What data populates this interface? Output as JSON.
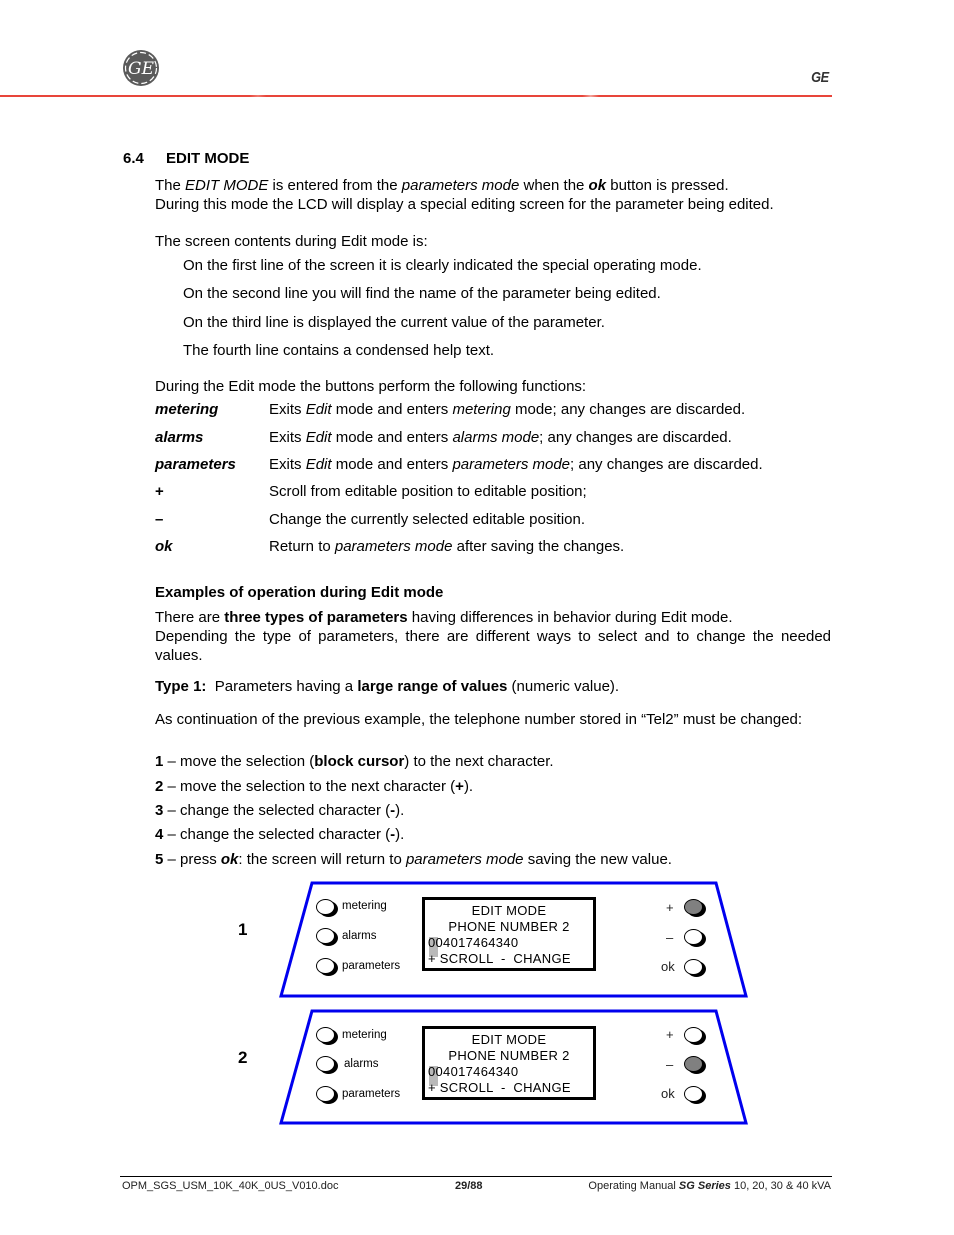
{
  "header": {
    "logo_icon": "ge-monogram-logo",
    "brand_text": "GE"
  },
  "section": {
    "number": "6.4",
    "title": "EDIT MODE"
  },
  "intro": {
    "l1_a": "The ",
    "l1_b": "EDIT MODE",
    "l1_c": " is entered from the ",
    "l1_d": "parameters mode",
    "l1_e": " when the ",
    "l1_f": "ok",
    "l1_g": " button is pressed.",
    "l2": "During this mode the LCD will display a special editing screen for the parameter being edited."
  },
  "screen_contents": {
    "heading": "The screen contents during Edit mode is:",
    "lines": [
      "On the first line of the screen it is clearly indicated the special operating mode.",
      "On the second line you will find the name of the parameter being edited.",
      "On the third line is displayed the current value of the parameter.",
      "The fourth line contains a condensed help text."
    ]
  },
  "functions": {
    "heading": "During the Edit mode the buttons perform the following functions:",
    "items": [
      {
        "key": "metering",
        "a": "Exits ",
        "b": "Edit",
        "c": " mode and enters ",
        "d": "metering",
        "e": " mode; any changes are discarded."
      },
      {
        "key": "alarms",
        "a": "Exits ",
        "b": "Edit",
        "c": " mode and enters ",
        "d": "alarms mode",
        "e": "; any changes are discarded."
      },
      {
        "key": "parameters",
        "a": "Exits ",
        "b": "Edit",
        "c": " mode and enters ",
        "d": "parameters mode",
        "e": "; any changes are discarded."
      },
      {
        "key": "+",
        "a": "Scroll from editable position to editable position;",
        "b": "",
        "c": "",
        "d": "",
        "e": ""
      },
      {
        "key": "–",
        "a": "Change the currently selected editable position.",
        "b": "",
        "c": "",
        "d": "",
        "e": ""
      },
      {
        "key": "ok",
        "a": "Return to ",
        "b": "",
        "c": "",
        "d": "parameters mode",
        "e": " after saving the changes."
      }
    ]
  },
  "examples": {
    "heading": "Examples of operation during Edit mode",
    "p1_a": "There are ",
    "p1_b": "three types of parameters",
    "p1_c": " having differences in behavior during Edit mode.",
    "p1_d": "Depending the type of parameters, there are different ways to select and to change the needed values.",
    "type1_label": "Type 1:",
    "type1_a": "  Parameters having a ",
    "type1_b": "large range of values",
    "type1_c": " (numeric value).",
    "continuation": "As continuation of the previous example, the telephone number stored in “Tel2” must be changed:",
    "steps": [
      {
        "num": "1",
        "a": " – move the selection (",
        "b": "block cursor",
        "c": ") to the next character.",
        "i": ""
      },
      {
        "num": "2",
        "a": " – move the selection to the next character (",
        "b": "+",
        "c": ").",
        "i": ""
      },
      {
        "num": "3",
        "a": " – change the selected character (",
        "b": "-",
        "c": ").",
        "i": ""
      },
      {
        "num": "4",
        "a": " – change the selected character (",
        "b": "-",
        "c": ").",
        "i": ""
      },
      {
        "num": "5",
        "a": " – press ",
        "b": "ok",
        "c": ": the screen will return to ",
        "i": "parameters mode",
        "d": " saving the new value."
      }
    ]
  },
  "panels": [
    {
      "label": "1",
      "left_buttons": [
        "metering",
        "alarms",
        "parameters"
      ],
      "right_buttons": [
        "+",
        "–",
        "ok"
      ],
      "pressed_button": "+",
      "lcd": [
        "EDIT MODE",
        "PHONE NUMBER 2",
        "004017464340",
        "+ SCROLL  -  CHANGE"
      ],
      "frame_color": "#0000ee",
      "pressed_color": "#808080"
    },
    {
      "label": "2",
      "left_buttons": [
        "metering",
        "alarms",
        "parameters"
      ],
      "right_buttons": [
        "+",
        "–",
        "ok"
      ],
      "pressed_button": "–",
      "lcd": [
        "EDIT MODE",
        "PHONE NUMBER 2",
        "004017464340",
        "+ SCROLL  -  CHANGE"
      ],
      "frame_color": "#0000ee",
      "pressed_color": "#808080"
    }
  ],
  "footer": {
    "doc_name": "OPM_SGS_USM_10K_40K_0US_V010.doc",
    "page": "29/88",
    "manual_a": "Operating Manual ",
    "manual_b": "SG Series",
    "manual_c": " 10, 20, 30 & 40 kVA"
  }
}
